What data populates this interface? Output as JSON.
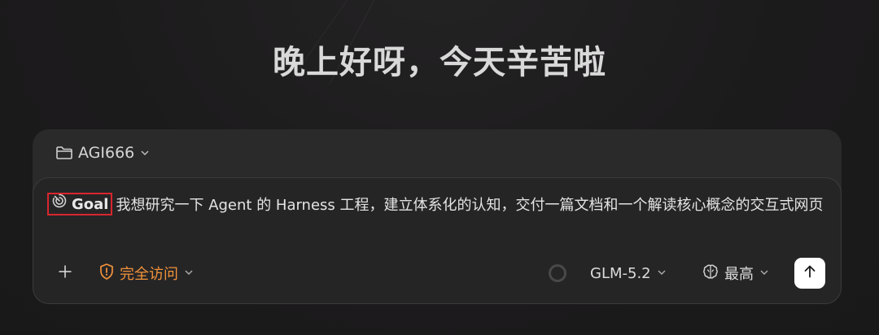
{
  "greeting": "晚上好呀，今天辛苦啦",
  "workspace": {
    "folder_icon": "folder-icon",
    "name": "AGI666"
  },
  "prompt": {
    "goal_icon": "goal-target-icon",
    "goal_label": "Goal",
    "text": "我想研究一下 Agent 的 Harness 工程，建立体系化的认知，交付一篇文档和一个解读核心概念的交互式网页"
  },
  "toolbar": {
    "add_icon": "plus-icon",
    "access_icon": "shield-icon",
    "access_label": "完全访问",
    "access_color": "#f0923a",
    "model_label": "GLM-5.2",
    "effort_icon": "brain-icon",
    "effort_label": "最高",
    "send_icon": "arrow-up-icon"
  },
  "colors": {
    "background": "#1c1b1c",
    "card": "#2b2a2b",
    "inner_card": "#262526",
    "highlight_border": "#d8262e",
    "send_button": "#ffffff"
  }
}
